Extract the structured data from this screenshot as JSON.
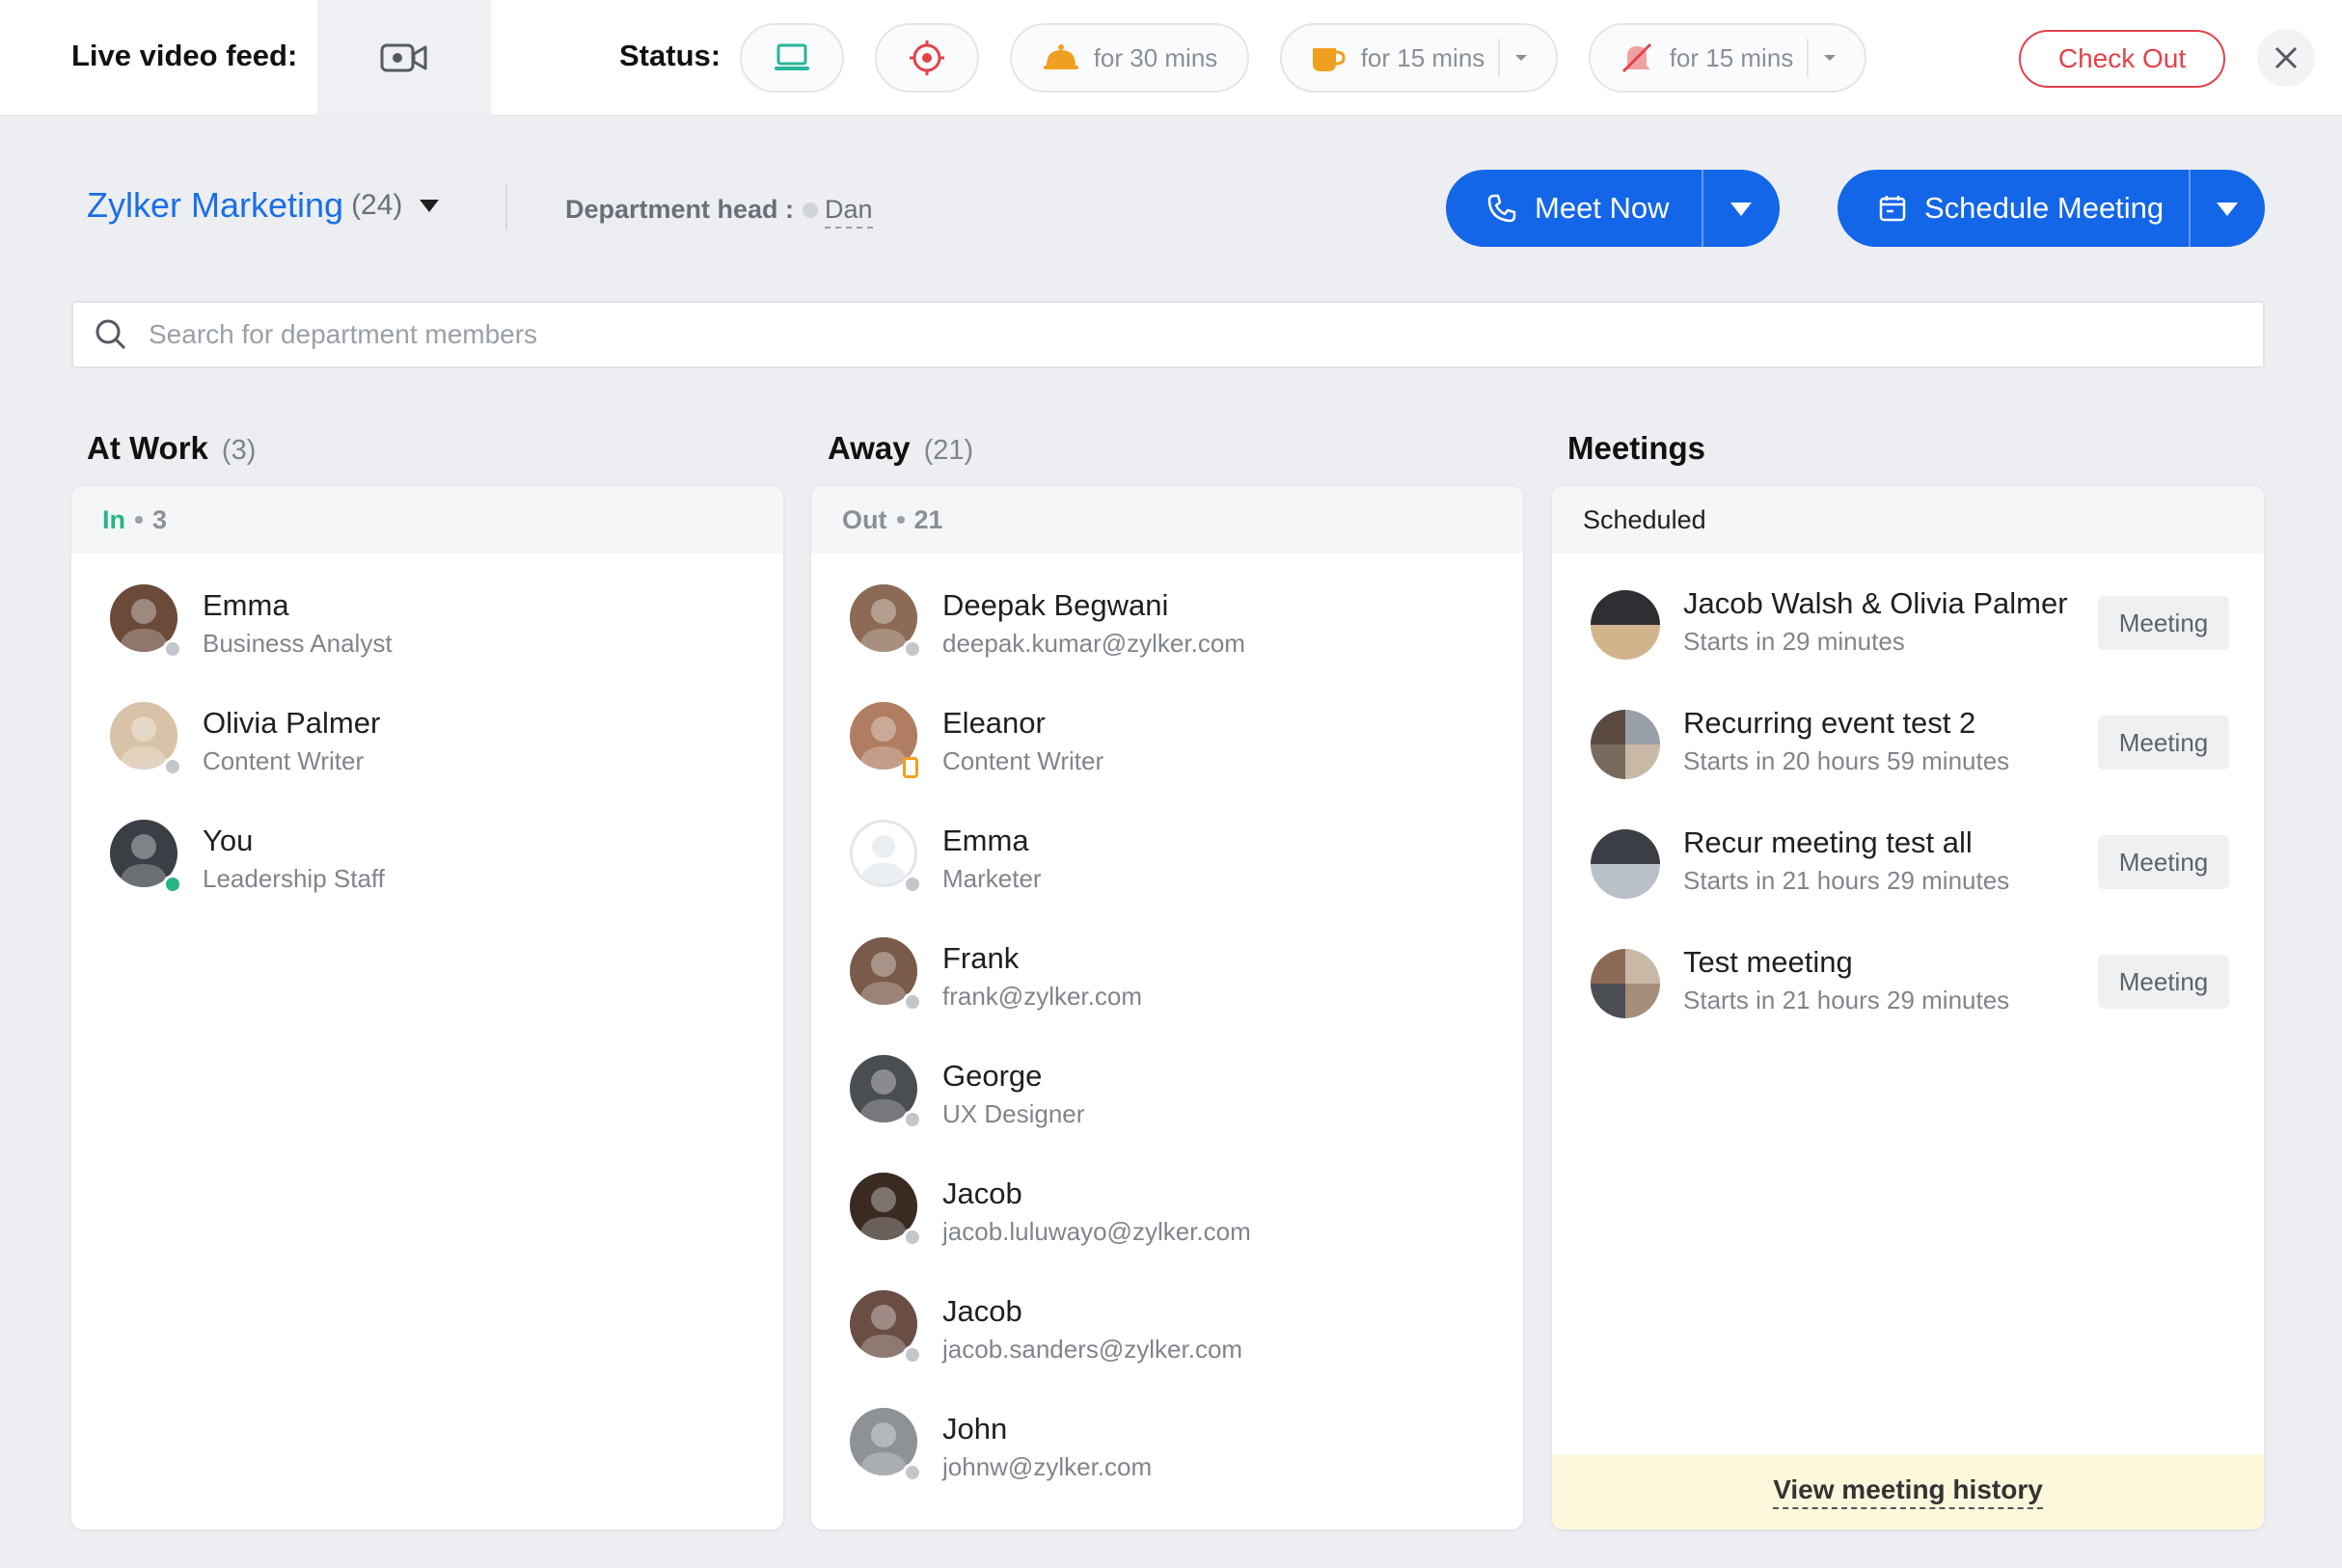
{
  "topbar": {
    "live_video_label": "Live video feed:",
    "status_label": "Status:",
    "pills": [
      {
        "icon": "laptop-icon",
        "color": "#2bb59a",
        "text": ""
      },
      {
        "icon": "target-icon",
        "color": "#e2434b",
        "text": ""
      },
      {
        "icon": "meal-icon",
        "color": "#f0a020",
        "text": "for 30 mins"
      },
      {
        "icon": "coffee-icon",
        "color": "#f0a020",
        "text": "for 15 mins"
      },
      {
        "icon": "mute-bell-icon",
        "color": "#e2434b",
        "text": "for 15 mins"
      }
    ],
    "check_out_label": "Check Out"
  },
  "header": {
    "department_name": "Zylker Marketing",
    "department_count": "(24)",
    "department_head_label": "Department head :",
    "department_head_name": "Dan",
    "meet_now_label": "Meet Now",
    "schedule_meeting_label": "Schedule Meeting"
  },
  "search": {
    "placeholder": "Search for department members",
    "value": ""
  },
  "at_work": {
    "title": "At Work",
    "count": "(3)",
    "sub_label": "In",
    "sub_count": "3",
    "members": [
      {
        "name": "Emma",
        "subtitle": "Business Analyst",
        "status": "offline",
        "avatar_color": "#6b4a3a"
      },
      {
        "name": "Olivia Palmer",
        "subtitle": "Content Writer",
        "status": "offline",
        "avatar_color": "#d8c3a8"
      },
      {
        "name": "You",
        "subtitle": "Leadership Staff",
        "status": "online",
        "avatar_color": "#3b3f45"
      }
    ]
  },
  "away": {
    "title": "Away",
    "count": "(21)",
    "sub_label": "Out",
    "sub_count": "21",
    "members": [
      {
        "name": "Deepak Begwani",
        "subtitle": "deepak.kumar@zylker.com",
        "status": "offline",
        "avatar_color": "#8c6a55"
      },
      {
        "name": "Eleanor",
        "subtitle": "Content Writer",
        "status": "mobile",
        "avatar_color": "#b07c62"
      },
      {
        "name": "Emma",
        "subtitle": "Marketer",
        "status": "offline",
        "avatar_color": "#e6e9ec"
      },
      {
        "name": "Frank",
        "subtitle": "frank@zylker.com",
        "status": "offline",
        "avatar_color": "#7a5a4a"
      },
      {
        "name": "George",
        "subtitle": "UX Designer",
        "status": "offline",
        "avatar_color": "#4a4d52"
      },
      {
        "name": "Jacob",
        "subtitle": "jacob.luluwayo@zylker.com",
        "status": "offline",
        "avatar_color": "#3a2a22"
      },
      {
        "name": "Jacob",
        "subtitle": "jacob.sanders@zylker.com",
        "status": "offline",
        "avatar_color": "#6a4e44"
      },
      {
        "name": "John",
        "subtitle": "johnw@zylker.com",
        "status": "offline",
        "avatar_color": "#8e9297"
      }
    ]
  },
  "meetings": {
    "title": "Meetings",
    "sub_label": "Scheduled",
    "items": [
      {
        "name": "Jacob Walsh & Olivia Palmer",
        "subtitle": "Starts in 29 minutes",
        "tag": "Meeting"
      },
      {
        "name": "Recurring event test 2",
        "subtitle": "Starts in 20 hours 59 minutes",
        "tag": "Meeting"
      },
      {
        "name": "Recur meeting test all",
        "subtitle": "Starts in 21 hours 29 minutes",
        "tag": "Meeting"
      },
      {
        "name": "Test meeting",
        "subtitle": "Starts in 21 hours 29 minutes",
        "tag": "Meeting"
      }
    ],
    "history_label": "View meeting history"
  },
  "colors": {
    "accent": "#1366e8",
    "online": "#27b489",
    "danger": "#e2434b"
  }
}
